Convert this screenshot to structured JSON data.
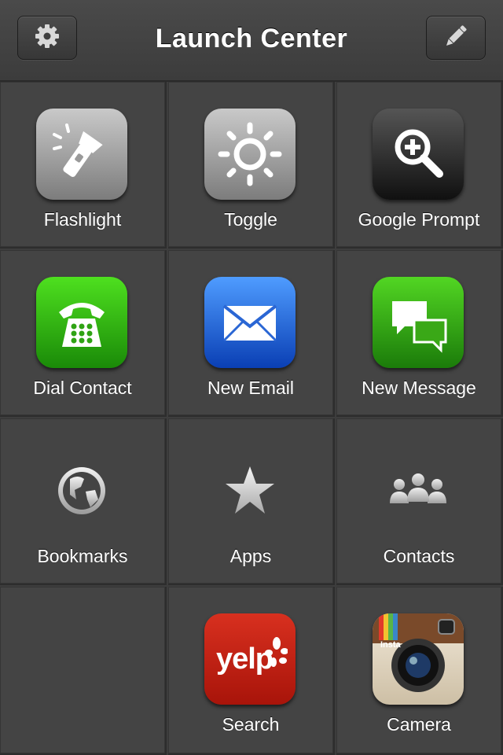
{
  "header": {
    "title": "Launch Center",
    "settings_icon": "gear-icon",
    "edit_icon": "pencil-icon"
  },
  "grid": {
    "cells": [
      {
        "label": "Flashlight",
        "icon": "flashlight-icon"
      },
      {
        "label": "Toggle",
        "icon": "sun-icon"
      },
      {
        "label": "Google Prompt",
        "icon": "magnify-plus-icon"
      },
      {
        "label": "Dial Contact",
        "icon": "phone-icon"
      },
      {
        "label": "New Email",
        "icon": "mail-icon"
      },
      {
        "label": "New Message",
        "icon": "message-icon"
      },
      {
        "label": "Bookmarks",
        "icon": "globe-icon"
      },
      {
        "label": "Apps",
        "icon": "star-icon"
      },
      {
        "label": "Contacts",
        "icon": "people-icon"
      },
      {
        "label": "",
        "icon": ""
      },
      {
        "label": "Search",
        "icon": "yelp-icon",
        "icon_text": "yelp"
      },
      {
        "label": "Camera",
        "icon": "instagram-icon",
        "icon_text": "Insta"
      }
    ]
  }
}
